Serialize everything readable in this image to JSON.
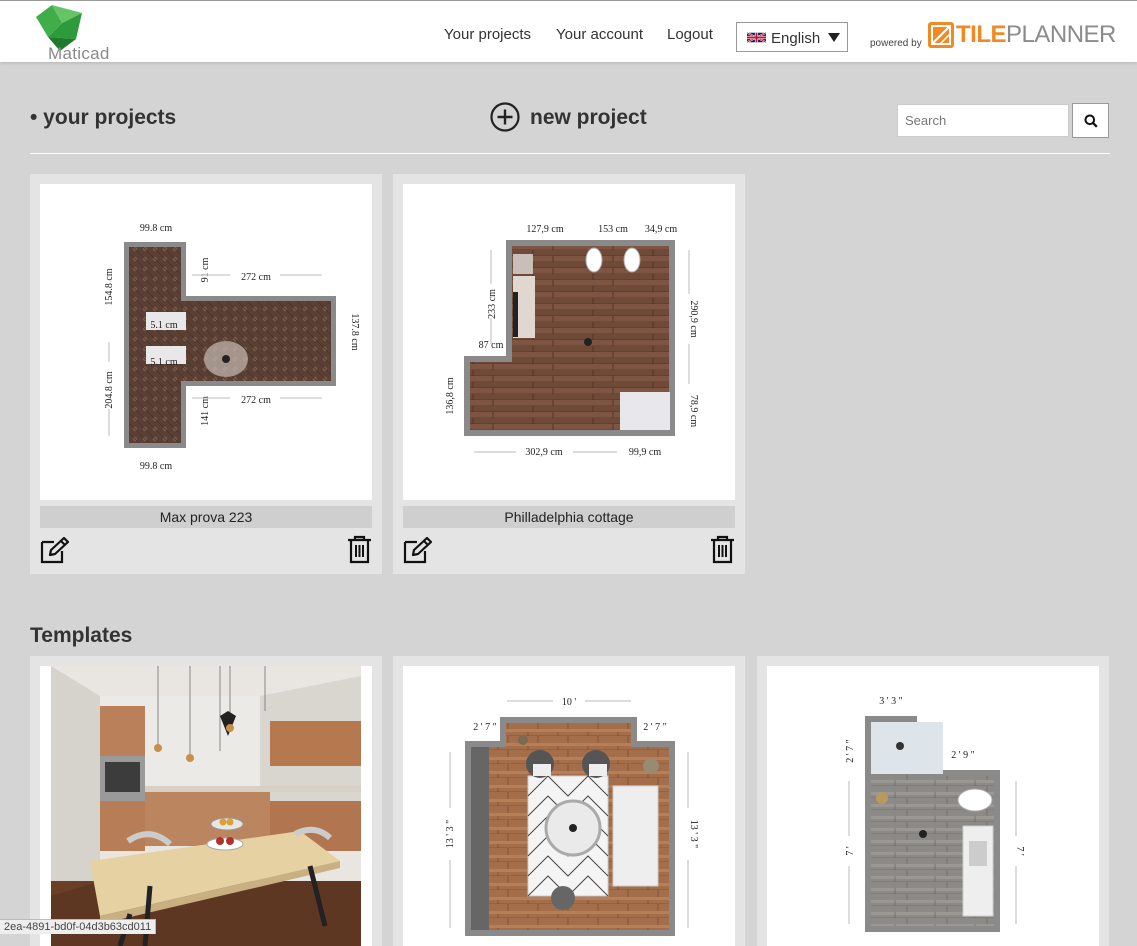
{
  "header": {
    "logo_text": "Maticad",
    "nav": [
      {
        "label": "Your projects"
      },
      {
        "label": "Your account"
      },
      {
        "label": "Logout"
      }
    ],
    "language": "English",
    "powered_by": "powered by",
    "brand_bold": "TILE",
    "brand_light": "PLANNER"
  },
  "projects_section": {
    "title": "• your projects",
    "new_project_label": "new project",
    "search_placeholder": "Search"
  },
  "projects": [
    {
      "name": "Max prova 223",
      "dims": [
        "99.8 cm",
        "272 cm",
        "91 cm",
        "154.8 cm",
        "5.1 cm",
        "5.1 cm",
        "137.8 cm",
        "204.8 cm",
        "272 cm",
        "141 cm",
        "99.8 cm"
      ]
    },
    {
      "name": "Philladelphia cottage",
      "dims": [
        "127,9 cm",
        "153 cm",
        "34,9 cm",
        "233 cm",
        "290,9 cm",
        "87 cm",
        "136,8 cm",
        "78,9 cm",
        "302,9 cm",
        "99,9 cm"
      ]
    }
  ],
  "templates_section": {
    "title": "Templates"
  },
  "templates": [
    {
      "type": "kitchen-render"
    },
    {
      "dims": [
        "10 '",
        "2 ' 7 \"",
        "2 ' 7 \"",
        "13 ' 3 \"",
        "13 ' 3 \""
      ]
    },
    {
      "dims": [
        "3 ' 3 \"",
        "2 ' 7 \"",
        "2 ' 9 \"",
        "7 '",
        "7 '"
      ]
    }
  ],
  "status_bar": "2ea-4891-bd0f-04d3b63cd011",
  "colors": {
    "background": "#d4d4d4",
    "card": "#e4e4e4",
    "name_bar": "#cfcfcf",
    "brand_orange": "#f08a24",
    "logo_green": "#3fae49"
  }
}
